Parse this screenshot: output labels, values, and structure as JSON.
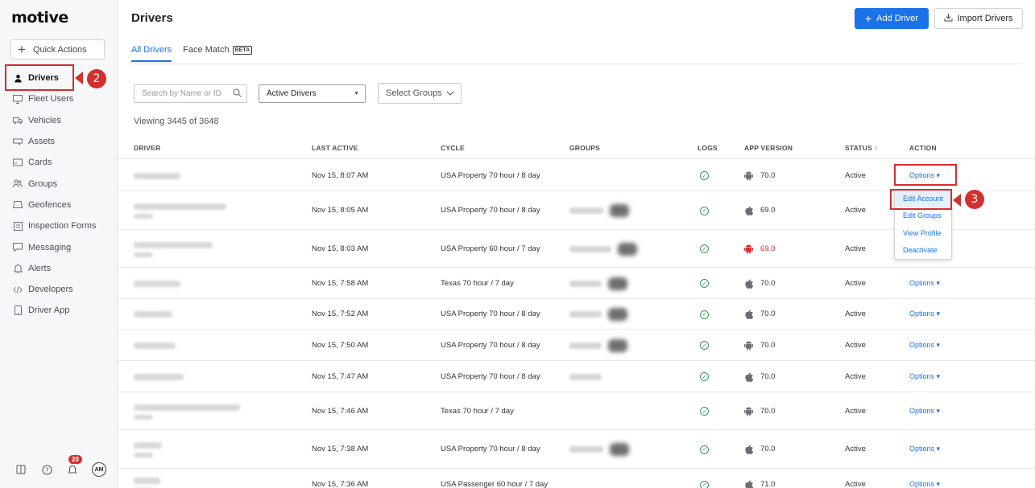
{
  "brand": {
    "logo": "motive"
  },
  "sidebar": {
    "quick_actions": "Quick Actions",
    "items": [
      {
        "label": "Drivers",
        "icon": "person-icon",
        "active": true
      },
      {
        "label": "Fleet Users",
        "icon": "monitor-icon"
      },
      {
        "label": "Vehicles",
        "icon": "truck-icon"
      },
      {
        "label": "Assets",
        "icon": "trailer-icon"
      },
      {
        "label": "Cards",
        "icon": "card-icon"
      },
      {
        "label": "Groups",
        "icon": "users-icon"
      },
      {
        "label": "Geofences",
        "icon": "geofence-icon"
      },
      {
        "label": "Inspection Forms",
        "icon": "clipboard-icon"
      },
      {
        "label": "Messaging",
        "icon": "message-icon"
      },
      {
        "label": "Alerts",
        "icon": "bell-icon"
      },
      {
        "label": "Developers",
        "icon": "code-icon"
      },
      {
        "label": "Driver App",
        "icon": "phone-icon"
      }
    ],
    "footer": {
      "notifications_count": "20",
      "avatar_initials": "AM"
    }
  },
  "callouts": {
    "drivers_step": "2",
    "edit_step": "3"
  },
  "header": {
    "title": "Drivers",
    "add_driver": "Add Driver",
    "import_drivers": "Import Drivers"
  },
  "tabs": [
    {
      "label": "All Drivers",
      "active": true
    },
    {
      "label": "Face Match",
      "badge": "BETA"
    }
  ],
  "filters": {
    "search_placeholder": "Search by Name or ID",
    "status_select": "Active Drivers",
    "groups_select": "Select Groups"
  },
  "viewing": "Viewing 3445 of 3648",
  "table": {
    "columns": [
      "DRIVER",
      "LAST ACTIVE",
      "CYCLE",
      "GROUPS",
      "LOGS",
      "APP VERSION",
      "STATUS ↑",
      "ACTION"
    ],
    "rows": [
      {
        "last_active": "Nov 15, 8:07 AM",
        "cycle": "USA Property 70 hour / 8 day",
        "os": "android",
        "version": "70.0",
        "version_alert": false,
        "status": "Active",
        "action": "Options ▾"
      },
      {
        "last_active": "Nov 15, 8:05 AM",
        "cycle": "USA Property 70 hour / 8 day",
        "os": "apple",
        "version": "69.0",
        "version_alert": false,
        "status": "Active",
        "action": ""
      },
      {
        "last_active": "Nov 15, 8:03 AM",
        "cycle": "USA Property 60 hour / 7 day",
        "os": "android",
        "version": "69.0",
        "version_alert": true,
        "status": "Active",
        "action": ""
      },
      {
        "last_active": "Nov 15, 7:58 AM",
        "cycle": "Texas 70 hour / 7 day",
        "os": "apple",
        "version": "70.0",
        "version_alert": false,
        "status": "Active",
        "action": "Options ▾"
      },
      {
        "last_active": "Nov 15, 7:52 AM",
        "cycle": "USA Property 70 hour / 8 day",
        "os": "apple",
        "version": "70.0",
        "version_alert": false,
        "status": "Active",
        "action": "Options ▾"
      },
      {
        "last_active": "Nov 15, 7:50 AM",
        "cycle": "USA Property 70 hour / 8 day",
        "os": "android",
        "version": "70.0",
        "version_alert": false,
        "status": "Active",
        "action": "Options ▾"
      },
      {
        "last_active": "Nov 15, 7:47 AM",
        "cycle": "USA Property 70 hour / 8 day",
        "os": "apple",
        "version": "70.0",
        "version_alert": false,
        "status": "Active",
        "action": "Options ▾"
      },
      {
        "last_active": "Nov 15, 7:46 AM",
        "cycle": "Texas 70 hour / 7 day",
        "os": "android",
        "version": "70.0",
        "version_alert": false,
        "status": "Active",
        "action": "Options ▾"
      },
      {
        "last_active": "Nov 15, 7:38 AM",
        "cycle": "USA Property 70 hour / 8 day",
        "os": "apple",
        "version": "70.0",
        "version_alert": false,
        "status": "Active",
        "action": "Options ▾"
      },
      {
        "last_active": "Nov 15, 7:36 AM",
        "cycle": "USA Passenger 60 hour / 7 day",
        "os": "apple",
        "version": "71.0",
        "version_alert": false,
        "status": "Active",
        "action": "Options ▾"
      }
    ]
  },
  "action_menu": [
    "Edit Account",
    "Edit Groups",
    "View Profile",
    "Deactivate"
  ],
  "colors": {
    "primary": "#1a73e8",
    "callout": "#d32f2f",
    "log_ok": "#2e9e4f"
  }
}
